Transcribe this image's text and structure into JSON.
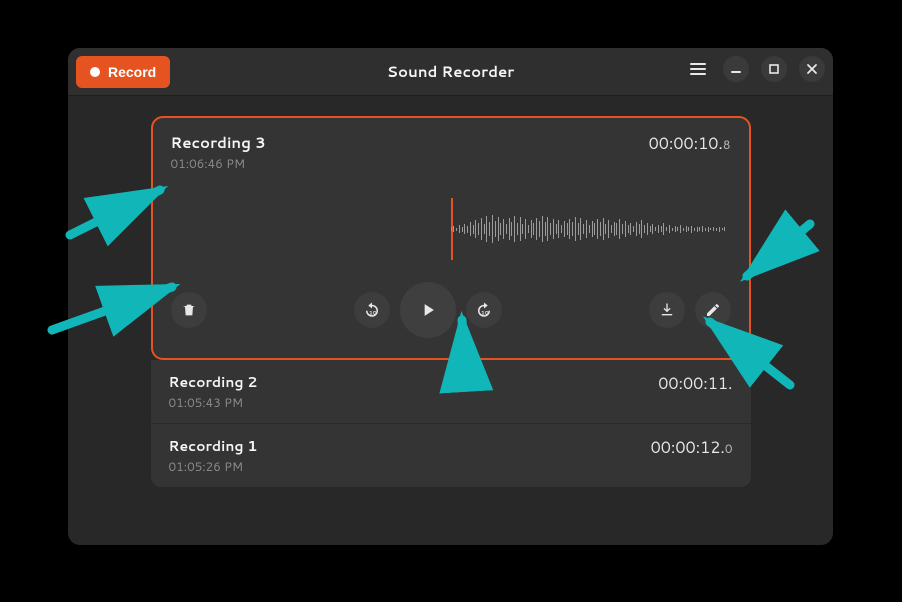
{
  "header": {
    "title": "Sound Recorder",
    "record_label": "Record"
  },
  "recordings": [
    {
      "title": "Recording 3",
      "time": "01:06:46 PM",
      "duration_main": "00:00:10.",
      "duration_dec": "8"
    },
    {
      "title": "Recording 2",
      "time": "01:05:43 PM",
      "duration_main": "00:00:11.",
      "duration_dec": ""
    },
    {
      "title": "Recording 1",
      "time": "01:05:26 PM",
      "duration_main": "00:00:12.",
      "duration_dec": "0"
    }
  ],
  "controls": {
    "delete": "trash-icon",
    "back10": "replay-10-icon",
    "play": "play-icon",
    "fwd10": "forward-10-icon",
    "export": "export-icon",
    "rename": "rename-icon"
  },
  "accent_color": "#e55321",
  "arrow_color": "#11b7b8"
}
